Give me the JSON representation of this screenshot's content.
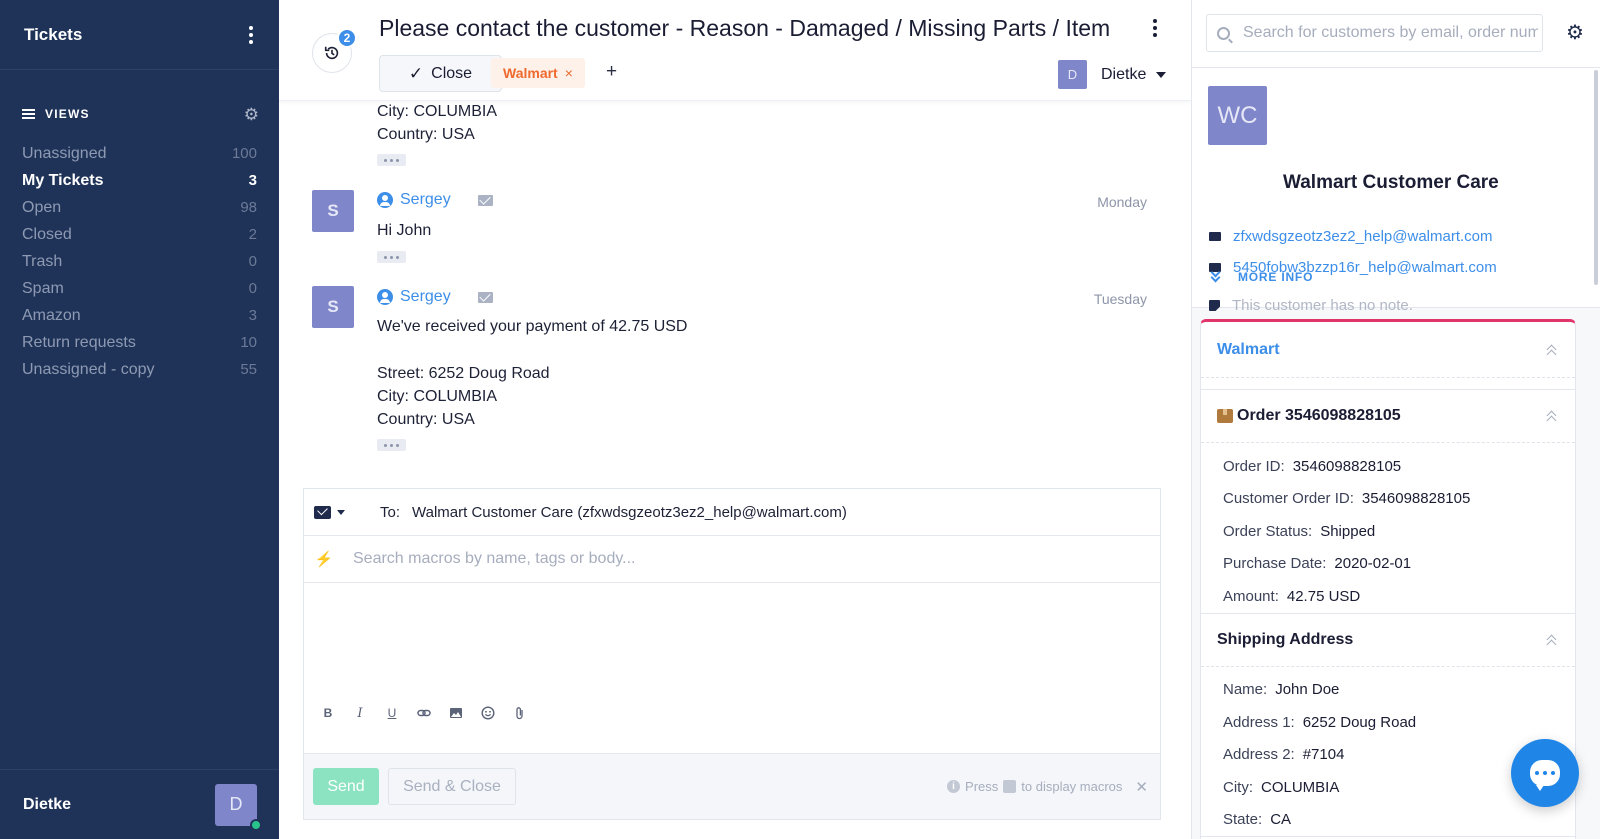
{
  "sidebar": {
    "title": "Tickets",
    "views_label": "VIEWS",
    "views": [
      {
        "label": "Unassigned",
        "count": "100"
      },
      {
        "label": "My Tickets",
        "count": "3"
      },
      {
        "label": "Open",
        "count": "98"
      },
      {
        "label": "Closed",
        "count": "2"
      },
      {
        "label": "Trash",
        "count": "0"
      },
      {
        "label": "Spam",
        "count": "0"
      },
      {
        "label": "Amazon",
        "count": "3"
      },
      {
        "label": "Return requests",
        "count": "10"
      },
      {
        "label": "Unassigned - copy",
        "count": "55"
      }
    ],
    "active_view": "My Tickets",
    "user_name": "Dietke",
    "user_initial": "D"
  },
  "ticket": {
    "history_count": "2",
    "title": "Please contact the customer - Reason - Damaged / Missing Parts / Item",
    "close_label": "Close",
    "tag": "Walmart",
    "tag_remove": "×",
    "add_tag": "+",
    "assignee_initial": "D",
    "assignee_name": "Dietke"
  },
  "thread": {
    "partial_lines": [
      "City: COLUMBIA",
      "Country: USA"
    ],
    "messages": [
      {
        "avatar": "S",
        "sender": "Sergey",
        "time": "Monday",
        "lines": [
          "Hi John"
        ]
      },
      {
        "avatar": "S",
        "sender": "Sergey",
        "time": "Tuesday",
        "lines": [
          "We've received your payment of 42.75 USD",
          "",
          "Street: 6252 Doug Road",
          "City: COLUMBIA",
          "Country: USA"
        ]
      }
    ]
  },
  "composer": {
    "to_label": "To:",
    "to_value": "Walmart Customer Care (zfxwdsgzeotz3ez2_help@walmart.com)",
    "macro_placeholder": "Search macros by name, tags or body...",
    "send_label": "Send",
    "send_close_label": "Send & Close",
    "hint_prefix": "Press",
    "hint_suffix": "to display macros",
    "toolbar": [
      "bold-icon",
      "italic-icon",
      "underline-icon",
      "link-icon",
      "image-icon",
      "emoji-icon",
      "attachment-icon"
    ]
  },
  "customer": {
    "search_placeholder": "Search for customers by email, order number...",
    "initials": "WC",
    "name": "Walmart Customer Care",
    "emails": [
      "zfxwdsgzeotz3ez2_help@walmart.com",
      "5450fobw3bzzp16r_help@walmart.com"
    ],
    "note": "This customer has no note.",
    "more_info": "MORE INFO"
  },
  "integration": {
    "title": "Walmart",
    "order_title": "Order 3546098828105",
    "order_fields": [
      {
        "key": "Order ID:",
        "value": "3546098828105"
      },
      {
        "key": "Customer Order ID:",
        "value": "3546098828105"
      },
      {
        "key": "Order Status:",
        "value": "Shipped"
      },
      {
        "key": "Purchase Date:",
        "value": "2020-02-01"
      },
      {
        "key": "Amount:",
        "value": "42.75 USD"
      }
    ],
    "shipping_title": "Shipping Address",
    "shipping_fields": [
      {
        "key": "Name:",
        "value": "John Doe"
      },
      {
        "key": "Address 1:",
        "value": "6252 Doug Road"
      },
      {
        "key": "Address 2:",
        "value": "#7104"
      },
      {
        "key": "City:",
        "value": "COLUMBIA"
      },
      {
        "key": "State:",
        "value": "CA"
      }
    ]
  },
  "colors": {
    "sidebar_bg": "#1f3358",
    "accent_blue": "#3d8ee8",
    "tag_orange": "#ef6a2e",
    "send_green": "#8be3c1",
    "integration_border": "#e0356b",
    "avatar_purple": "#7f86c9"
  }
}
